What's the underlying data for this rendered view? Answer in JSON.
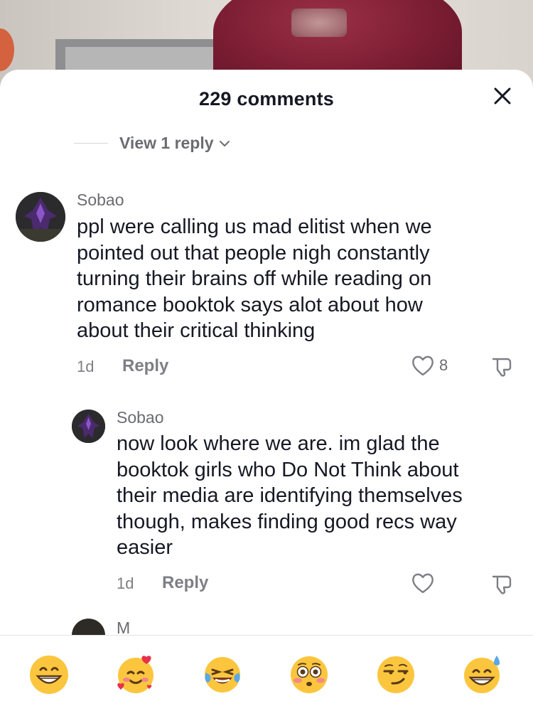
{
  "header": {
    "title": "229 comments"
  },
  "thread": {
    "view_replies_label": "View 1 reply"
  },
  "comments": [
    {
      "username": "Sobao",
      "text_lines": [
        "ppl were calling us mad elitist when we",
        "pointed out that people nigh constantly",
        "turning their brains off while reading on",
        "romance booktok says alot about how",
        "about their critical thinking"
      ],
      "time": "1d",
      "reply_label": "Reply",
      "likes": "8"
    },
    {
      "username": "Sobao",
      "text_lines": [
        "now look where we are. im glad the",
        "booktok girls who Do Not Think about",
        "their media are identifying themselves",
        "though, makes finding good recs way",
        "easier"
      ],
      "time": "1d",
      "reply_label": "Reply",
      "likes": ""
    }
  ],
  "partial_comment": {
    "username": "M"
  },
  "emoji_bar": [
    "grinning-face",
    "smiling-face-with-hearts",
    "tears-of-joy",
    "flushed-face",
    "smirking-face",
    "grinning-face-with-sweat"
  ],
  "colors": {
    "text": "#161823",
    "muted": "#7e7f85",
    "emoji_yellow": "#fbc63e"
  }
}
